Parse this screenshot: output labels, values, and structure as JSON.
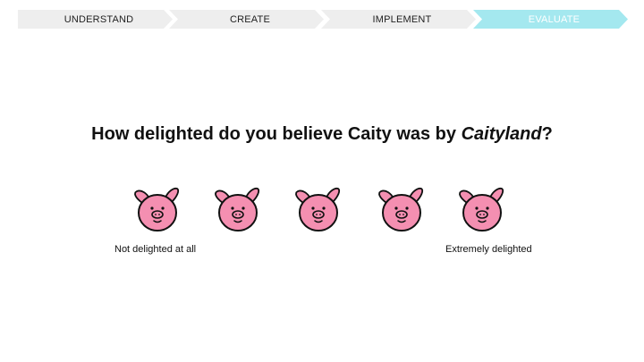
{
  "progress_steps": [
    {
      "label": "UNDERSTAND",
      "state": "inactive"
    },
    {
      "label": "CREATE",
      "state": "inactive"
    },
    {
      "label": "IMPLEMENT",
      "state": "inactive"
    },
    {
      "label": "EVALUATE",
      "state": "active"
    }
  ],
  "colors": {
    "step_inactive_bg": "#eeeeee",
    "step_active_bg": "#a4e8ef",
    "pig_face": "#f48fb1",
    "pig_outline": "#111111"
  },
  "question": {
    "prefix": "How delighted do you believe Caity was by ",
    "emphasis": "Caityland",
    "suffix": "?"
  },
  "scale": {
    "options": [
      {
        "icon": "pig-face-icon",
        "value": 1
      },
      {
        "icon": "pig-face-icon",
        "value": 2
      },
      {
        "icon": "pig-face-icon",
        "value": 3
      },
      {
        "icon": "pig-face-icon",
        "value": 4
      },
      {
        "icon": "pig-face-icon",
        "value": 5
      }
    ],
    "min_label": "Not delighted at all",
    "max_label": "Extremely delighted"
  }
}
